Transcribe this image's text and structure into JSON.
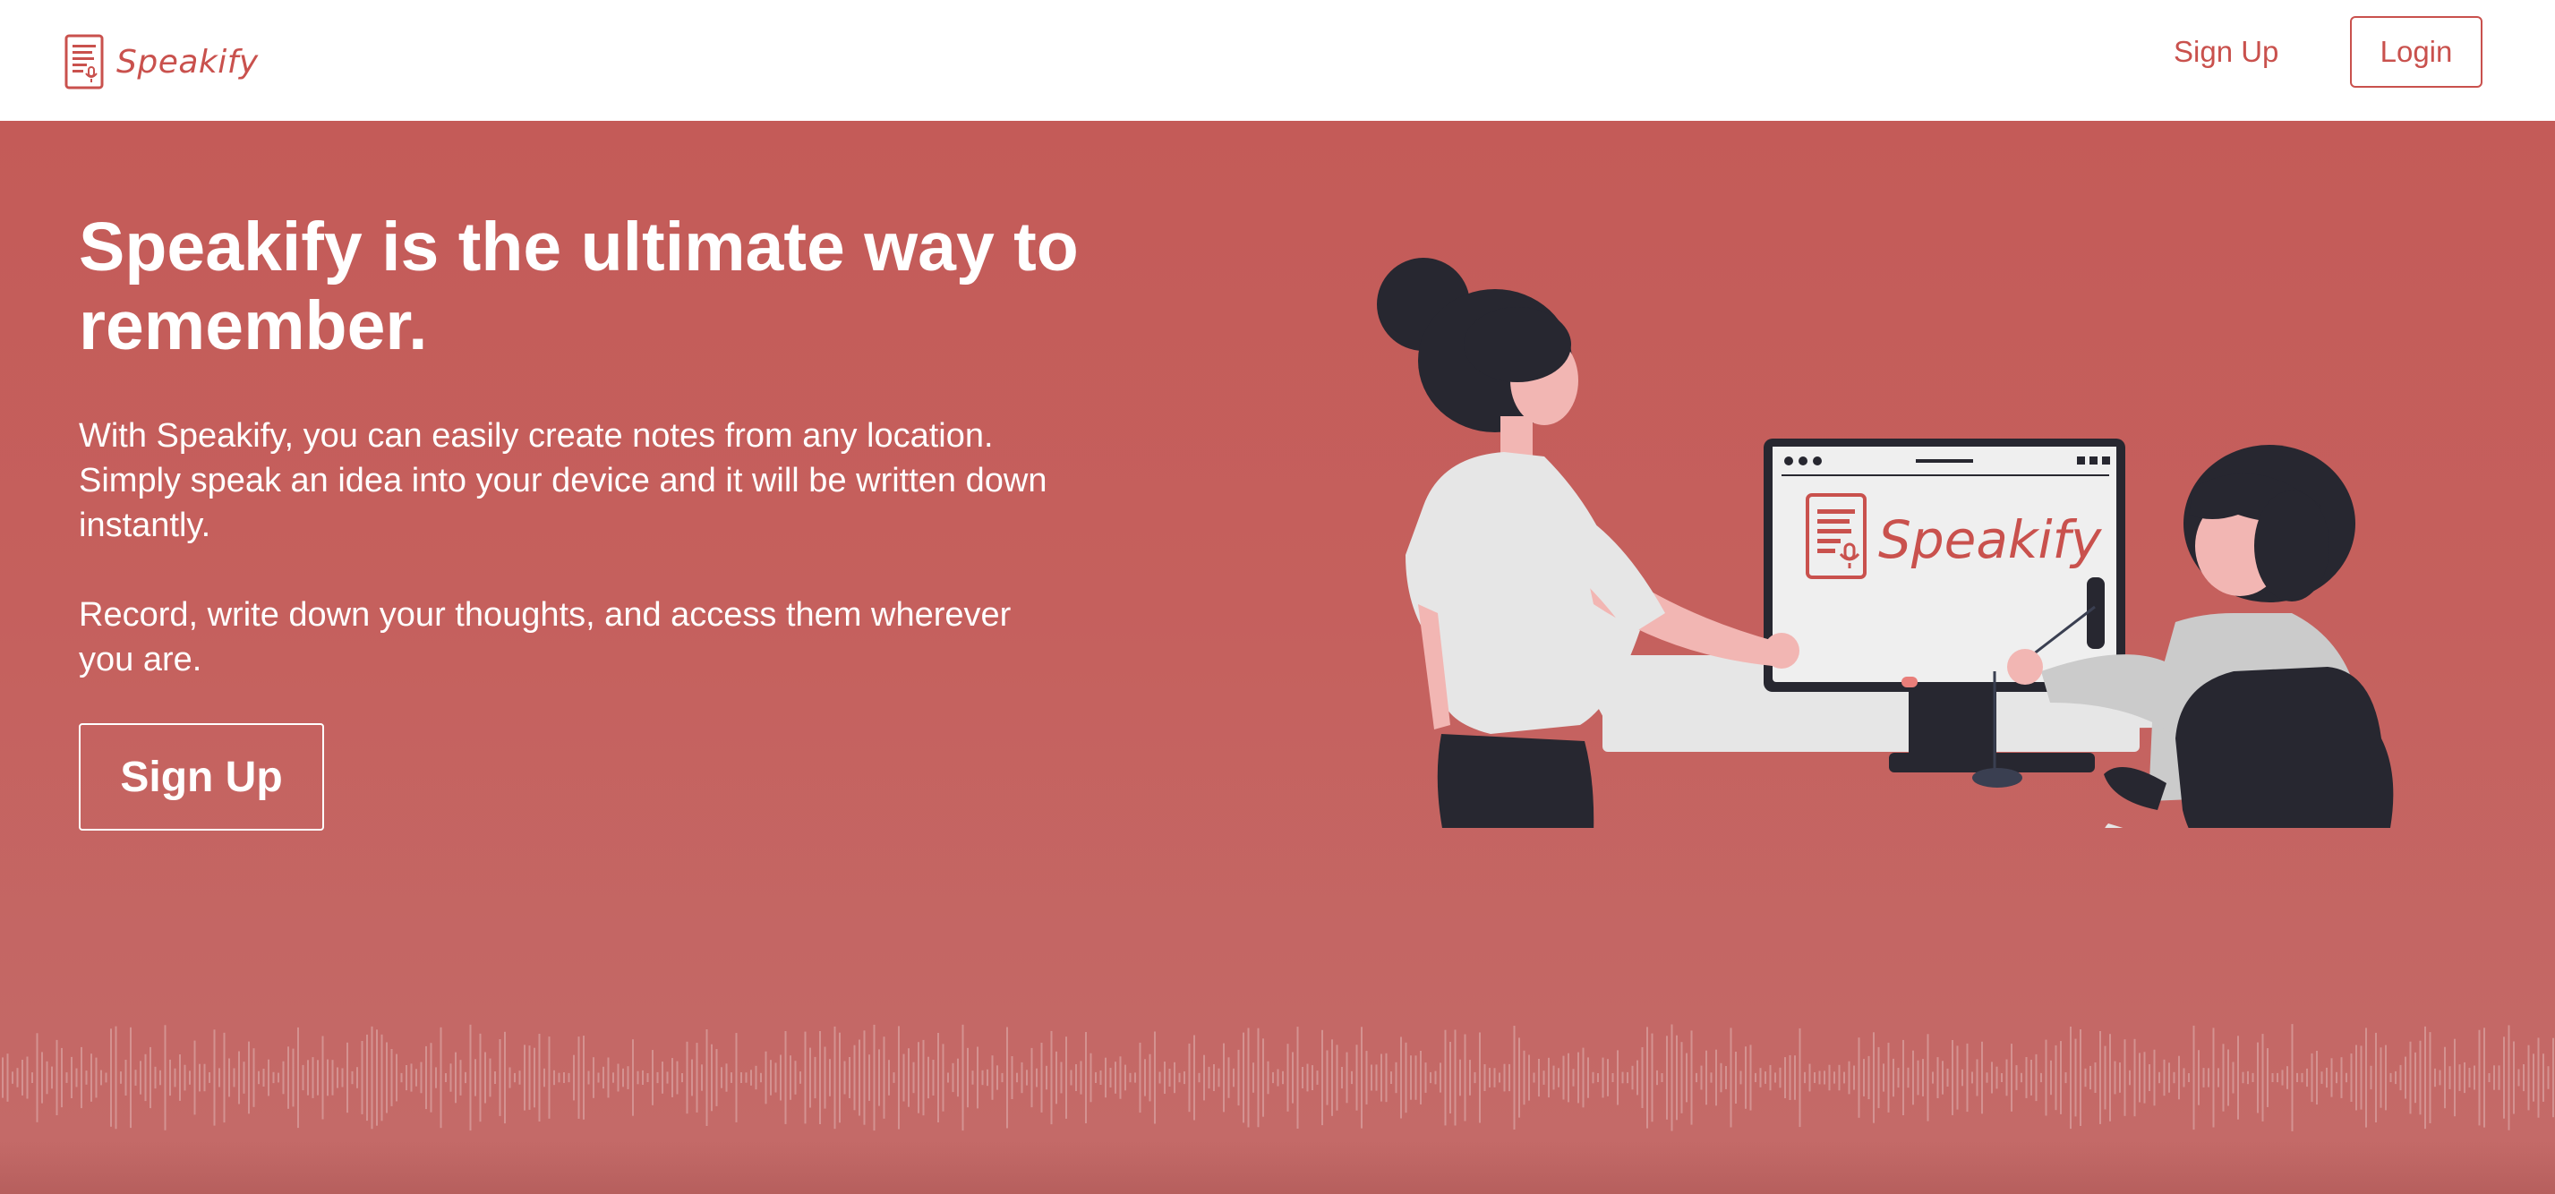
{
  "nav": {
    "brand_name": "Speakify",
    "signup_label": "Sign Up",
    "login_label": "Login"
  },
  "hero": {
    "title": "Speakify is the ultimate way to remember.",
    "paragraph_1": "With Speakify, you can easily create notes from any location. Simply speak an idea into your device and it will be written down instantly.",
    "paragraph_2": "Record, write down your thoughts, and access them wherever you are.",
    "cta_label": "Sign Up"
  },
  "illustration": {
    "screen_brand": "Speakify"
  },
  "colors": {
    "brand": "#c9514d",
    "hero_background": "#c45e5b",
    "dark": "#272730",
    "skin": "#f2b6b3",
    "light_gray": "#e6e6e6"
  },
  "icons": {
    "brand_logo": "notepad-microphone-icon",
    "waveform": "audio-waveform-decoration"
  }
}
